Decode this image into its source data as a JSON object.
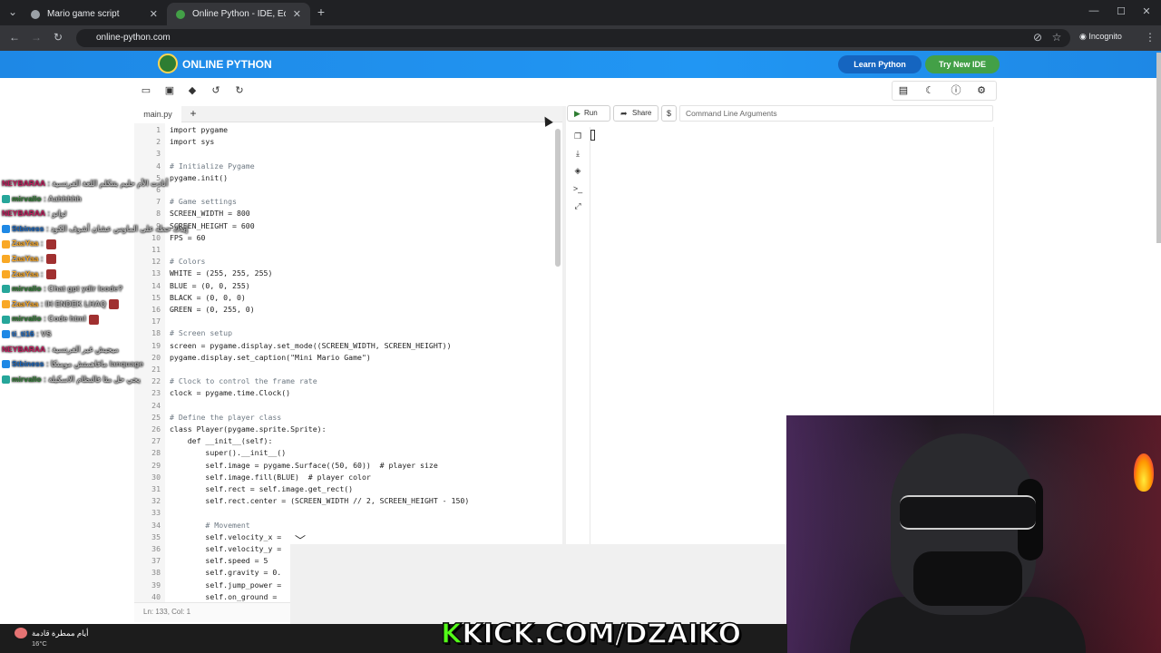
{
  "browser": {
    "tabs": [
      {
        "title": "Mario game script",
        "close": "✕"
      },
      {
        "title": "Online Python - IDE, Editor, Co",
        "close": "✕"
      }
    ],
    "new_tab": "+",
    "url": "online-python.com",
    "incognito_label": "Incognito",
    "window_controls": {
      "minimize": "—",
      "maximize": "☐",
      "close": "✕"
    }
  },
  "site": {
    "brand": "ONLINE PYTHON",
    "learn_button": "Learn Python",
    "try_button": "Try New IDE"
  },
  "toolbar": {
    "icons": [
      "folder-open-icon",
      "save-icon",
      "eraser-icon",
      "undo-icon",
      "redo-icon"
    ],
    "right_icons": [
      "layout-icon",
      "moon-icon",
      "info-icon",
      "gear-icon"
    ]
  },
  "editor": {
    "file_tab": "main.py",
    "add_tab": "+",
    "status": "Ln: 133,  Col: 1",
    "lines": [
      {
        "n": "1",
        "code": "import pygame"
      },
      {
        "n": "2",
        "code": "import sys"
      },
      {
        "n": "3",
        "code": ""
      },
      {
        "n": "4",
        "code": "# Initialize Pygame"
      },
      {
        "n": "5",
        "code": "pygame.init()"
      },
      {
        "n": "6",
        "code": ""
      },
      {
        "n": "7",
        "code": "# Game settings"
      },
      {
        "n": "8",
        "code": "SCREEN_WIDTH = 800"
      },
      {
        "n": "9",
        "code": "SCREEN_HEIGHT = 600"
      },
      {
        "n": "10",
        "code": "FPS = 60"
      },
      {
        "n": "11",
        "code": ""
      },
      {
        "n": "12",
        "code": "# Colors"
      },
      {
        "n": "13",
        "code": "WHITE = (255, 255, 255)"
      },
      {
        "n": "14",
        "code": "BLUE = (0, 0, 255)"
      },
      {
        "n": "15",
        "code": "BLACK = (0, 0, 0)"
      },
      {
        "n": "16",
        "code": "GREEN = (0, 255, 0)"
      },
      {
        "n": "17",
        "code": ""
      },
      {
        "n": "18",
        "code": "# Screen setup"
      },
      {
        "n": "19",
        "code": "screen = pygame.display.set_mode((SCREEN_WIDTH, SCREEN_HEIGHT))"
      },
      {
        "n": "20",
        "code": "pygame.display.set_caption(\"Mini Mario Game\")"
      },
      {
        "n": "21",
        "code": ""
      },
      {
        "n": "22",
        "code": "# Clock to control the frame rate"
      },
      {
        "n": "23",
        "code": "clock = pygame.time.Clock()"
      },
      {
        "n": "24",
        "code": ""
      },
      {
        "n": "25",
        "code": "# Define the player class"
      },
      {
        "n": "26",
        "code": "class Player(pygame.sprite.Sprite):"
      },
      {
        "n": "27",
        "code": "    def __init__(self):"
      },
      {
        "n": "28",
        "code": "        super().__init__()"
      },
      {
        "n": "29",
        "code": "        self.image = pygame.Surface((50, 60))  # player size"
      },
      {
        "n": "30",
        "code": "        self.image.fill(BLUE)  # player color"
      },
      {
        "n": "31",
        "code": "        self.rect = self.image.get_rect()"
      },
      {
        "n": "32",
        "code": "        self.rect.center = (SCREEN_WIDTH // 2, SCREEN_HEIGHT - 150)"
      },
      {
        "n": "33",
        "code": ""
      },
      {
        "n": "34",
        "code": "        # Movement"
      },
      {
        "n": "35",
        "code": "        self.velocity_x ="
      },
      {
        "n": "36",
        "code": "        self.velocity_y ="
      },
      {
        "n": "37",
        "code": "        self.speed = 5"
      },
      {
        "n": "38",
        "code": "        self.gravity = 0."
      },
      {
        "n": "39",
        "code": "        self.jump_power ="
      },
      {
        "n": "40",
        "code": "        self.on_ground ="
      }
    ]
  },
  "run_panel": {
    "run": "Run",
    "share": "Share",
    "dollar": "$",
    "args_placeholder": "Command Line Arguments",
    "console_icons": [
      "copy-icon",
      "download-icon",
      "clear-icon",
      "terminal-icon",
      "expand-icon"
    ]
  },
  "chat": [
    {
      "user": "NEYBARAA",
      "msg": ": أنادت الأم حليم بتتكلم اللغة الفرنسية",
      "color": "pink"
    },
    {
      "user": "mirvallo",
      "msg": ": Aahhhhh",
      "color": "green"
    },
    {
      "user": "NEYBARAA",
      "msg": ": ثوانو",
      "color": "pink"
    },
    {
      "user": "Stbiness",
      "msg": ": إيدك حطه على الماوس عشان أشوف الكود",
      "color": "blue"
    },
    {
      "user": "ZaaYaa",
      "msg": ":",
      "color": "gold",
      "emote": true
    },
    {
      "user": "ZaaYaa",
      "msg": ":",
      "color": "gold",
      "emote": true
    },
    {
      "user": "ZaaYaa",
      "msg": ":",
      "color": "gold",
      "emote": true
    },
    {
      "user": "mirvallo",
      "msg": ": Chat gpt ydir lcode?",
      "color": "green"
    },
    {
      "user": "ZaaYaa",
      "msg": ": IH ENDEK LHAQ",
      "color": "gold",
      "emote": true
    },
    {
      "user": "mirvallo",
      "msg": ": Code html",
      "color": "green",
      "emote": true
    },
    {
      "user": "ti_ti16",
      "msg": ": VS",
      "color": "blue"
    },
    {
      "user": "NEYBARAA",
      "msg": ": ميجيش غير الفرنسية",
      "color": "pink"
    },
    {
      "user": "Stbiness",
      "msg": ": مافاهمتش مومنكا lanquage",
      "color": "blue"
    },
    {
      "user": "mirvallo",
      "msg": ": يجي حل مثا فالنظام الاسكبلة",
      "color": "green"
    }
  ],
  "stream": {
    "banner_prefix": "K",
    "banner": "KICK.COM/DZAIKO"
  },
  "taskbar": {
    "weather_desc": "أيام ممطرة قادمة",
    "weather_temp": "16°C"
  }
}
